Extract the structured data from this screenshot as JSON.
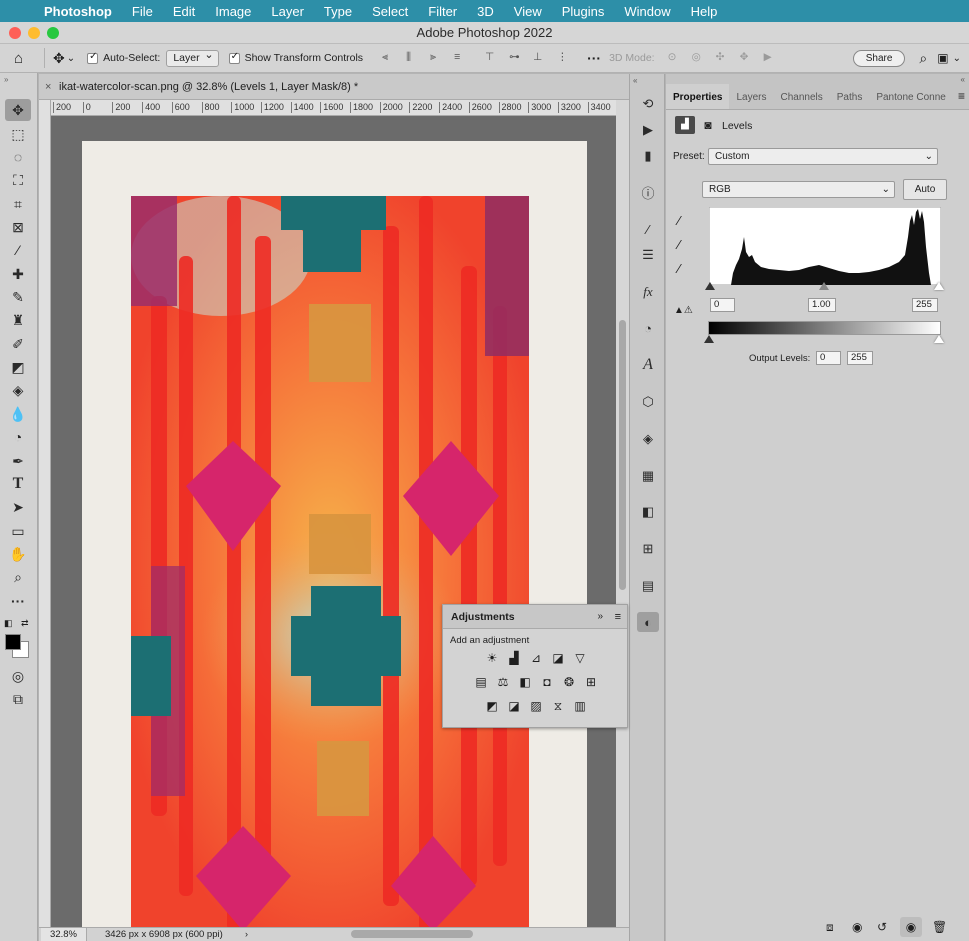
{
  "menubar": {
    "app": "Photoshop",
    "items": [
      "File",
      "Edit",
      "Image",
      "Layer",
      "Type",
      "Select",
      "Filter",
      "3D",
      "View",
      "Plugins",
      "Window",
      "Help"
    ]
  },
  "window": {
    "title": "Adobe Photoshop 2022"
  },
  "options_bar": {
    "auto_select_label": "Auto-Select:",
    "auto_select_value": "Layer",
    "show_transform_label": "Show Transform Controls",
    "mode_3d": "3D Mode:",
    "share_label": "Share"
  },
  "document": {
    "tab_title": "ikat-watercolor-scan.png @ 32.8% (Levels 1, Layer Mask/8) *",
    "ruler_ticks": [
      "200",
      "0",
      "200",
      "400",
      "600",
      "800",
      "1000",
      "1200",
      "1400",
      "1600",
      "1800",
      "2000",
      "2200",
      "2400",
      "2600",
      "2800",
      "3000",
      "3200",
      "3400"
    ]
  },
  "status": {
    "zoom": "32.8%",
    "info": "3426 px x 6908 px (600 ppi)"
  },
  "properties": {
    "tabs": [
      "Properties",
      "Layers",
      "Channels",
      "Paths",
      "Pantone Conne"
    ],
    "active_tab": "Properties",
    "section_title": "Levels",
    "preset_label": "Preset:",
    "preset_value": "Custom",
    "channel_value": "RGB",
    "auto_label": "Auto",
    "input_black": "0",
    "input_gamma": "1.00",
    "input_white": "255",
    "output_label": "Output Levels:",
    "output_black": "0",
    "output_white": "255"
  },
  "adjustments": {
    "title": "Adjustments",
    "subtitle": "Add an adjustment",
    "icons": [
      [
        "brightness-contrast-icon",
        "levels-icon",
        "curves-icon",
        "exposure-icon",
        "vibrance-icon"
      ],
      [
        "hue-saturation-icon",
        "color-balance-icon",
        "black-white-icon",
        "photo-filter-icon",
        "channel-mixer-icon",
        "color-lookup-icon"
      ],
      [
        "invert-icon",
        "posterize-icon",
        "threshold-icon",
        "selective-color-icon",
        "gradient-map-icon"
      ]
    ]
  },
  "colors": {
    "menubar_bg": "#2d8fa8",
    "canvas_bg": "#6b6b6b",
    "panel_bg": "#cfcfcf",
    "paper": "#efece6"
  }
}
